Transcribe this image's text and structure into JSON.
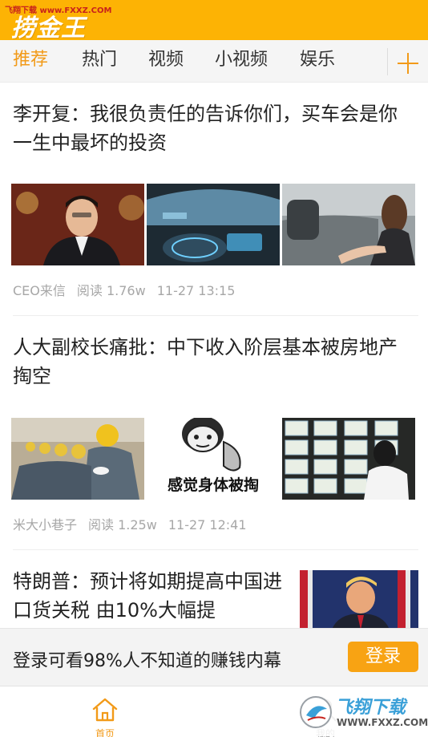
{
  "header": {
    "site_tag": "飞翔下载 www.FXXZ.COM",
    "brand": "捞金王"
  },
  "tabs": [
    {
      "label": "推荐",
      "active": true
    },
    {
      "label": "热门",
      "active": false
    },
    {
      "label": "视频",
      "active": false
    },
    {
      "label": "小视频",
      "active": false
    },
    {
      "label": "娱乐",
      "active": false
    }
  ],
  "add_channel_icon": "plus-icon",
  "articles": [
    {
      "title": "李开复：我很负责任的告诉你们，买车会是你一生中最坏的投资",
      "source": "CEO来信",
      "reads": "阅读 1.76w",
      "time": "11-27 13:15"
    },
    {
      "title": "人大副校长痛批：中下收入阶层基本被房地产掏空",
      "source": "米大小巷子",
      "reads": "阅读 1.25w",
      "time": "11-27 12:41",
      "image_caption": "感觉身体被掏"
    },
    {
      "title": "特朗普：预计将如期提高中国进口货关税 由10%大幅提"
    }
  ],
  "login_banner": {
    "text": "登录可看98%人不知道的赚钱内幕",
    "button": "登录"
  },
  "bottom_nav": [
    {
      "label": "首页",
      "icon": "home-icon",
      "active": true
    },
    {
      "label": "我的",
      "icon": "profile-icon",
      "active": false
    }
  ],
  "watermark": {
    "main": "飞翔下载",
    "sub": "WWW.FXXZ.COM"
  },
  "colors": {
    "brand": "#fdb304",
    "accent": "#f29a18",
    "login_button": "#f8a313"
  }
}
